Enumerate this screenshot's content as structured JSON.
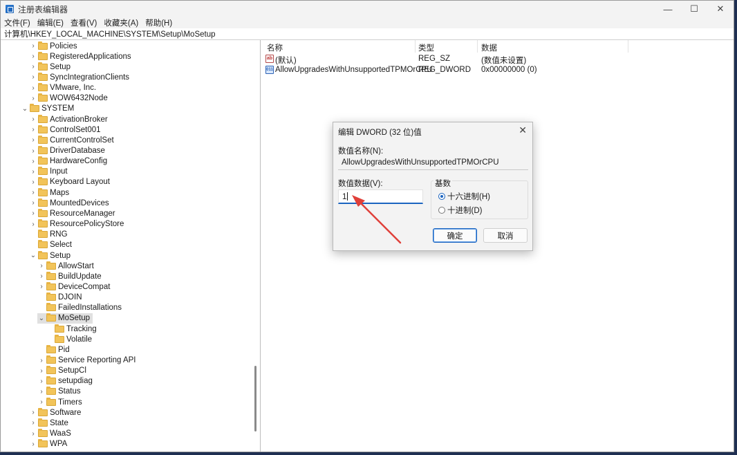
{
  "window": {
    "title": "注册表编辑器",
    "controls": {
      "minimize": "—",
      "maximize": "☐",
      "close": "✕"
    }
  },
  "menu": [
    "文件(F)",
    "编辑(E)",
    "查看(V)",
    "收藏夹(A)",
    "帮助(H)"
  ],
  "address": "计算机\\HKEY_LOCAL_MACHINE\\SYSTEM\\Setup\\MoSetup",
  "tree": [
    {
      "label": "Policies"
    },
    {
      "label": "RegisteredApplications"
    },
    {
      "label": "Setup"
    },
    {
      "label": "SyncIntegrationClients"
    },
    {
      "label": "VMware, Inc."
    },
    {
      "label": "WOW6432Node"
    },
    {
      "label": "SYSTEM"
    },
    {
      "label": "ActivationBroker"
    },
    {
      "label": "ControlSet001"
    },
    {
      "label": "CurrentControlSet"
    },
    {
      "label": "DriverDatabase"
    },
    {
      "label": "HardwareConfig"
    },
    {
      "label": "Input"
    },
    {
      "label": "Keyboard Layout"
    },
    {
      "label": "Maps"
    },
    {
      "label": "MountedDevices"
    },
    {
      "label": "ResourceManager"
    },
    {
      "label": "ResourcePolicyStore"
    },
    {
      "label": "RNG"
    },
    {
      "label": "Select"
    },
    {
      "label": "Setup"
    },
    {
      "label": "AllowStart"
    },
    {
      "label": "BuildUpdate"
    },
    {
      "label": "DeviceCompat"
    },
    {
      "label": "DJOIN"
    },
    {
      "label": "FailedInstallations"
    },
    {
      "label": "MoSetup"
    },
    {
      "label": "Tracking"
    },
    {
      "label": "Volatile"
    },
    {
      "label": "Pid"
    },
    {
      "label": "Service Reporting API"
    },
    {
      "label": "SetupCl"
    },
    {
      "label": "setupdiag"
    },
    {
      "label": "Status"
    },
    {
      "label": "Timers"
    },
    {
      "label": "Software"
    },
    {
      "label": "State"
    },
    {
      "label": "WaaS"
    },
    {
      "label": "WPA"
    }
  ],
  "list": {
    "headers": {
      "name": "名称",
      "type": "类型",
      "data": "数据"
    },
    "rows": [
      {
        "icon": "string-value-icon",
        "name": "(默认)",
        "type": "REG_SZ",
        "data": "(数值未设置)"
      },
      {
        "icon": "dword-value-icon",
        "name": "AllowUpgradesWithUnsupportedTPMOrCPU",
        "type": "REG_DWORD",
        "data": "0x00000000 (0)"
      }
    ]
  },
  "dialog": {
    "title": "编辑 DWORD (32 位)值",
    "name_label": "数值名称(N):",
    "name_value": "AllowUpgradesWithUnsupportedTPMOrCPU",
    "data_label": "数值数据(V):",
    "data_value": "1",
    "base_label": "基数",
    "hex_label": "十六进制(H)",
    "dec_label": "十进制(D)",
    "selected_base": "hex",
    "ok_label": "确定",
    "cancel_label": "取消"
  },
  "colors": {
    "accent": "#1a64c0",
    "annotation_arrow": "#e0403a",
    "folder": "#f2c45a"
  }
}
